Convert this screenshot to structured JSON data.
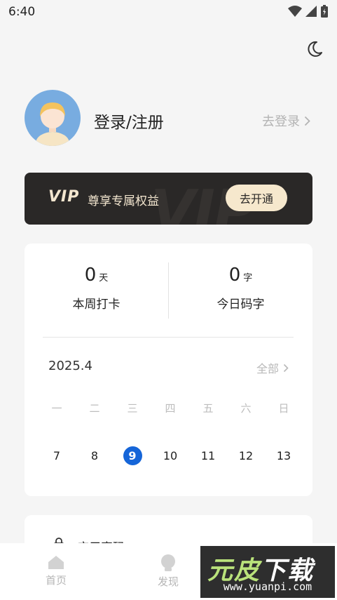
{
  "status_bar": {
    "time": "6:40"
  },
  "profile": {
    "title": "登录/注册",
    "action": "去登录"
  },
  "vip": {
    "logo": "VIP",
    "text": "尊享专属权益",
    "button": "去开通",
    "watermark": "VIP"
  },
  "stats": [
    {
      "value": "0",
      "unit": "天",
      "label": "本周打卡"
    },
    {
      "value": "0",
      "unit": "字",
      "label": "今日码字"
    }
  ],
  "calendar": {
    "month": "2025.4",
    "all_label": "全部",
    "weekdays": [
      "一",
      "二",
      "三",
      "四",
      "五",
      "六",
      "日"
    ],
    "dates": [
      "7",
      "8",
      "9",
      "10",
      "11",
      "12",
      "13"
    ],
    "today": "9"
  },
  "card2": {
    "label": "应用密码"
  },
  "tabs": [
    {
      "label": "首页",
      "icon": "home-icon"
    },
    {
      "label": "发现",
      "icon": "bulb-icon"
    }
  ],
  "watermark": {
    "brand_a": "元皮",
    "brand_b": "下载",
    "url": "www.yuanpi.com"
  },
  "colors": {
    "accent": "#1565d8",
    "vip_bg": "#2a2827",
    "vip_gold": "#f3e6cf"
  }
}
